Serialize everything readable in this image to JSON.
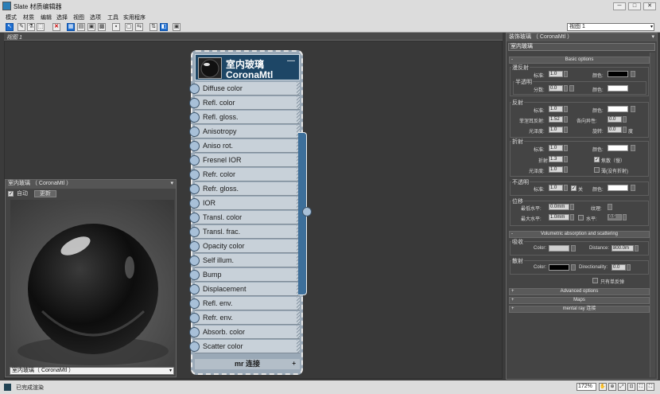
{
  "window": {
    "title": "Slate 材质编辑器",
    "min": "─",
    "max": "□",
    "close": "✕"
  },
  "menu": [
    "模式",
    "材质",
    "编辑",
    "选择",
    "视图",
    "选项",
    "工具",
    "实用程序"
  ],
  "toolbar": [
    "↖",
    "✎",
    "⚗",
    "⬚",
    "✕",
    "▦",
    "▤",
    "▣",
    "▩",
    "▪",
    "▢",
    "⇆",
    "⇅",
    "◧",
    "▣",
    "⊞"
  ],
  "view_selector": {
    "value": "视图 1",
    "arrow": "▾"
  },
  "tab": {
    "label": "视图 1"
  },
  "preview": {
    "title": "室内玻璃 （ CoronaMtl ）",
    "close": "▾",
    "auto_label": "自动",
    "auto_checked": "✓",
    "update_label": "更新",
    "selector_value": "室内玻璃（ CoronaMtl ）",
    "selector_arrow": "▾"
  },
  "node": {
    "title": "室内玻璃",
    "subtitle": "CoronaMtl",
    "minimize": "—",
    "slots": [
      "Diffuse color",
      "Refl. color",
      "Refl. gloss.",
      "Anisotropy",
      "Aniso rot.",
      "Fresnel IOR",
      "Refr. color",
      "Refr. gloss.",
      "IOR",
      "Transl. color",
      "Transl. frac.",
      "Opacity color",
      "Self illum.",
      "Bump",
      "Displacement",
      "Refl. env.",
      "Refr. env.",
      "Absorb. color",
      "Scatter color"
    ],
    "footer": "mr 连接",
    "footer_plus": "+"
  },
  "params": {
    "header": "装饰玻璃 （ CoronaMtl ）",
    "header_close": "▾",
    "material_name": "室内玻璃",
    "basic_rollout": "Basic options",
    "diffuse_group": "漫反射",
    "level_label": "标准:",
    "color_label": "颜色:",
    "diffuse_level": "1.0",
    "translucency_group": "半透明",
    "fraction_label": "分数:",
    "transl_fraction": "0.0",
    "reflection_group": "反射",
    "refl_level": "1.0",
    "fresnel_label": "菲涅耳反射:",
    "fresnel_value": "1.52",
    "aniso_label": "各向异性:",
    "aniso_value": "0.0",
    "gloss_label": "光泽度:",
    "refl_gloss": "1.0",
    "rotation_label": "旋转:",
    "rotation_value": "0.0",
    "degree_unit": "度",
    "refraction_group": "折射",
    "refr_level": "1.0",
    "ior_label": "折射",
    "ior_value": "1.3",
    "thin_label": "焦散（慢）",
    "thin_checked": "✓",
    "refr_gloss": "1.0",
    "caustics_label": "薄(没有折射)",
    "opacity_group": "不透明",
    "opacity_level": "1.0",
    "opacity_flag": "关",
    "opacity_checked": "✓",
    "displacement_group": "位移",
    "min_level_label": "最低水平:",
    "min_level_value": "0.0mm",
    "texture_label": "纹理:",
    "max_level_label": "最大水平:",
    "max_level_value": "1.0mm",
    "water_label": "水平:",
    "water_value": "0.5",
    "volumetric_rollout": "Volumetric absorption and scattering",
    "absorption_group": "吸收",
    "abs_color_label": "Color:",
    "distance_label": "Distance:",
    "distance_value": "800.0m",
    "scatter_group": "散射",
    "scat_color_label": "Color:",
    "directionality_label": "Directionality:",
    "directionality_value": "0.0",
    "single_bounce_label": "只有单反弹",
    "advanced_rollout": "Advanced options",
    "maps_rollout": "Maps",
    "mentalray_rollout": "mental ray 连接",
    "rollout_plus": "+",
    "rollout_minus": "-",
    "colors": {
      "diffuse": "#000000",
      "reflection": "#ffffff",
      "refraction": "#ffffff",
      "opacity": "#ffffff",
      "absorption": "#cfcfcf",
      "scatter": "#000000"
    }
  },
  "status": {
    "text": "已完成渲染",
    "zoom": "172%",
    "nav_icons": [
      "✋",
      "⊕",
      "⤢",
      "⊡",
      "⛶",
      "⛶",
      "⛶"
    ]
  }
}
